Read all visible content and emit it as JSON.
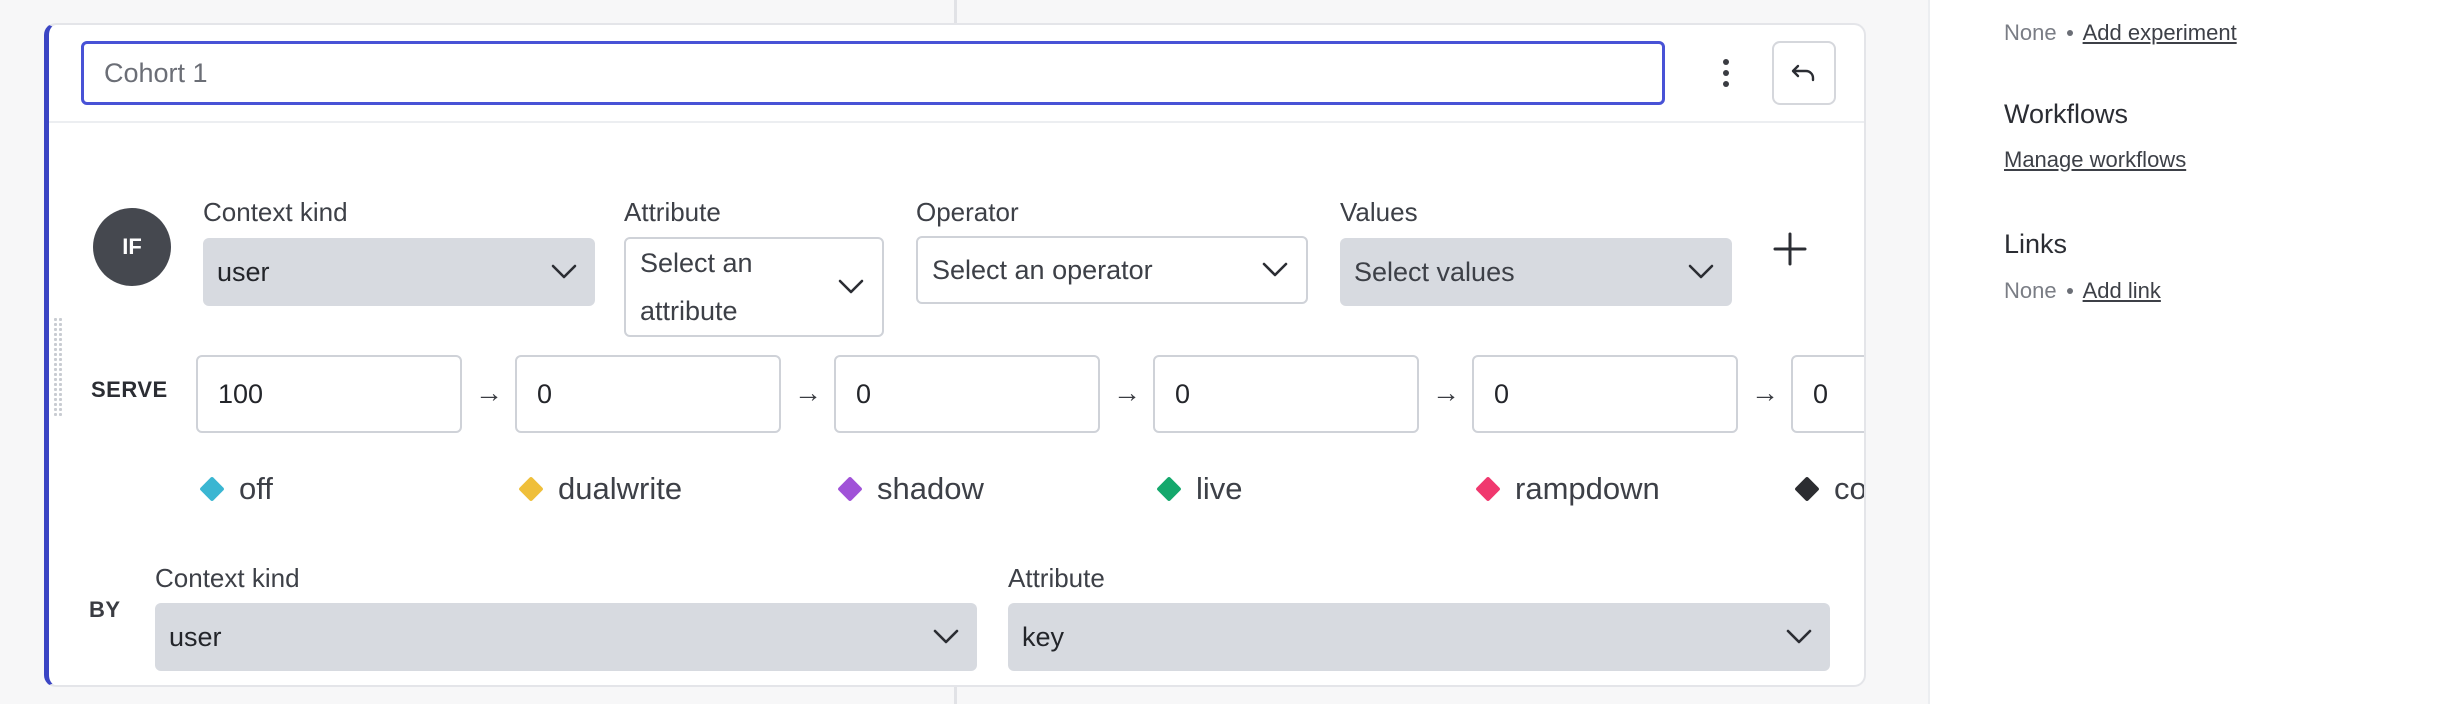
{
  "rule": {
    "name_value": "Cohort 1",
    "if_badge": "IF",
    "clause": {
      "context_kind_label": "Context kind",
      "context_kind_value": "user",
      "attribute_label": "Attribute",
      "attribute_placeholder": "Select an attribute",
      "operator_label": "Operator",
      "operator_placeholder": "Select an operator",
      "values_label": "Values",
      "values_placeholder": "Select values"
    },
    "serve": {
      "label": "SERVE",
      "arrow": "→",
      "rollouts": [
        {
          "value": "100",
          "variation": "off",
          "color": "#3ab6d2"
        },
        {
          "value": "0",
          "variation": "dualwrite",
          "color": "#efbf3a"
        },
        {
          "value": "0",
          "variation": "shadow",
          "color": "#a052d8"
        },
        {
          "value": "0",
          "variation": "live",
          "color": "#14a86c"
        },
        {
          "value": "0",
          "variation": "rampdown",
          "color": "#f0386e"
        },
        {
          "value": "0",
          "variation": "complete",
          "color": "#2c2d31"
        }
      ]
    },
    "by": {
      "label": "BY",
      "context_kind_label": "Context kind",
      "context_kind_value": "user",
      "attribute_label": "Attribute",
      "attribute_value": "key"
    }
  },
  "sidebar": {
    "experiments": {
      "none": "None",
      "link": "Add experiment"
    },
    "workflows": {
      "title": "Workflows",
      "link": "Manage workflows"
    },
    "links": {
      "title": "Links",
      "none": "None",
      "link": "Add link"
    }
  },
  "colors": {
    "accent": "#3b45c4",
    "select_bg": "#d7dae0"
  }
}
